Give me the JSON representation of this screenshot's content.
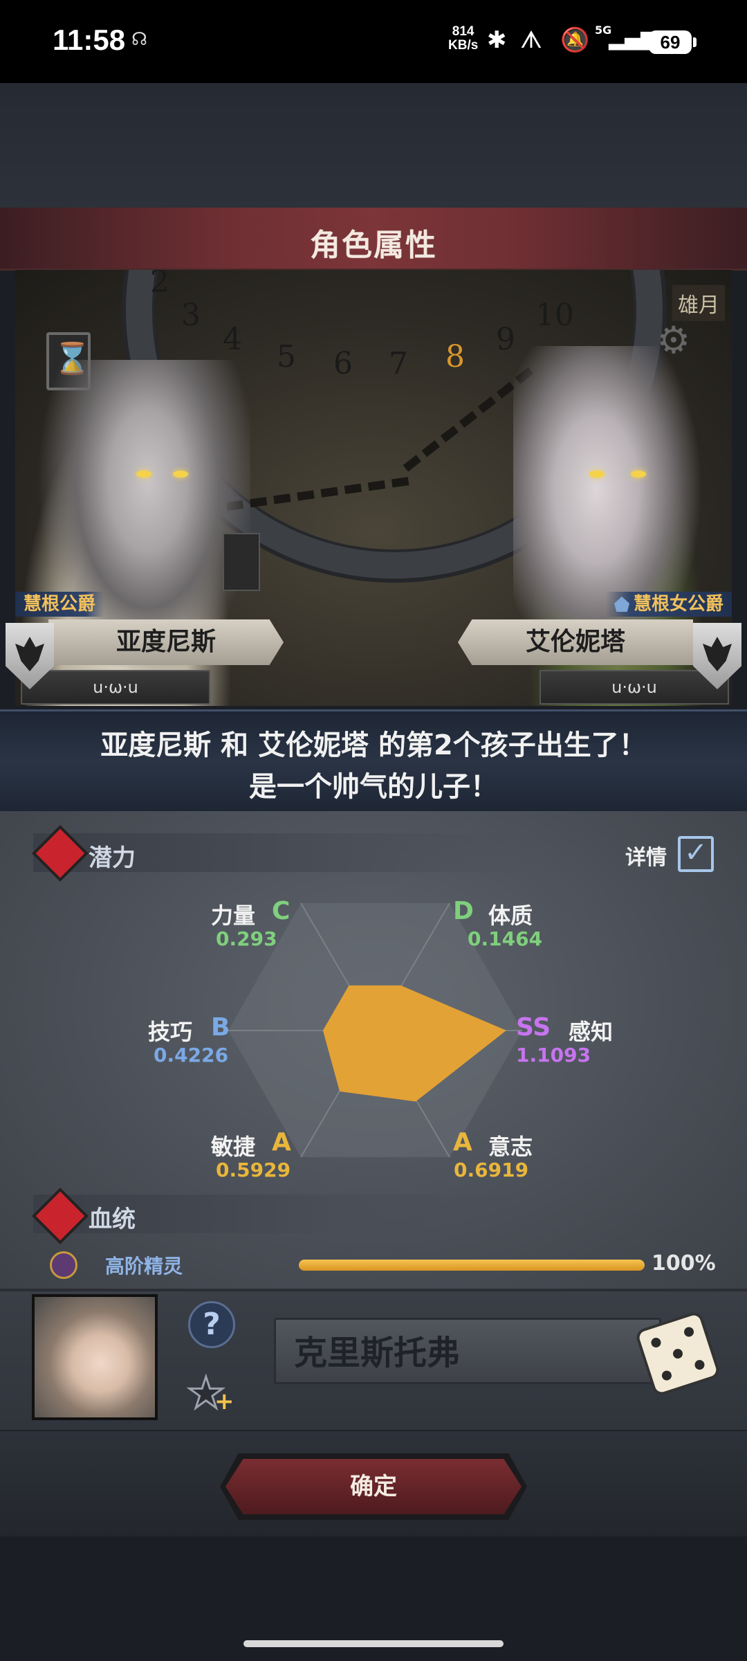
{
  "status_bar": {
    "time": "11:58",
    "net_speed_value": "814",
    "net_speed_unit": "KB/s",
    "network": "5G",
    "battery": "69"
  },
  "header": {
    "title": "角色属性"
  },
  "scene": {
    "wheel_numbers": [
      "2",
      "3",
      "4",
      "5",
      "6",
      "7",
      "8",
      "9",
      "10"
    ],
    "active_number": "8",
    "month_label": "雄月"
  },
  "father": {
    "title": "慧根公爵",
    "name": "亚度尼斯",
    "status": "u·ω·u"
  },
  "mother": {
    "title": "慧根女公爵",
    "name": "艾伦妮塔",
    "status": "u·ω·u"
  },
  "announcement": {
    "line1": "亚度尼斯 和 艾伦妮塔 的第2个孩子出生了！",
    "line2": "是一个帅气的儿子！"
  },
  "potential": {
    "label": "潜力",
    "detail_label": "详情",
    "detail_checked": true,
    "stats": {
      "strength": {
        "name": "力量",
        "grade": "C",
        "value": "0.293"
      },
      "constitution": {
        "name": "体质",
        "grade": "D",
        "value": "0.1464"
      },
      "perception": {
        "name": "感知",
        "grade": "SS",
        "value": "1.1093"
      },
      "will": {
        "name": "意志",
        "grade": "A",
        "value": "0.6919"
      },
      "agility": {
        "name": "敏捷",
        "grade": "A",
        "value": "0.5929"
      },
      "skill": {
        "name": "技巧",
        "grade": "B",
        "value": "0.4226"
      }
    },
    "radar_color": "#e3a235"
  },
  "bloodline": {
    "label": "血统",
    "name": "高阶精灵",
    "percent_text": "100%",
    "fraction": 1.0
  },
  "child": {
    "name_value": "克里斯托弗",
    "help_label": "?",
    "star_plus": "+"
  },
  "confirm_label": "确定"
}
